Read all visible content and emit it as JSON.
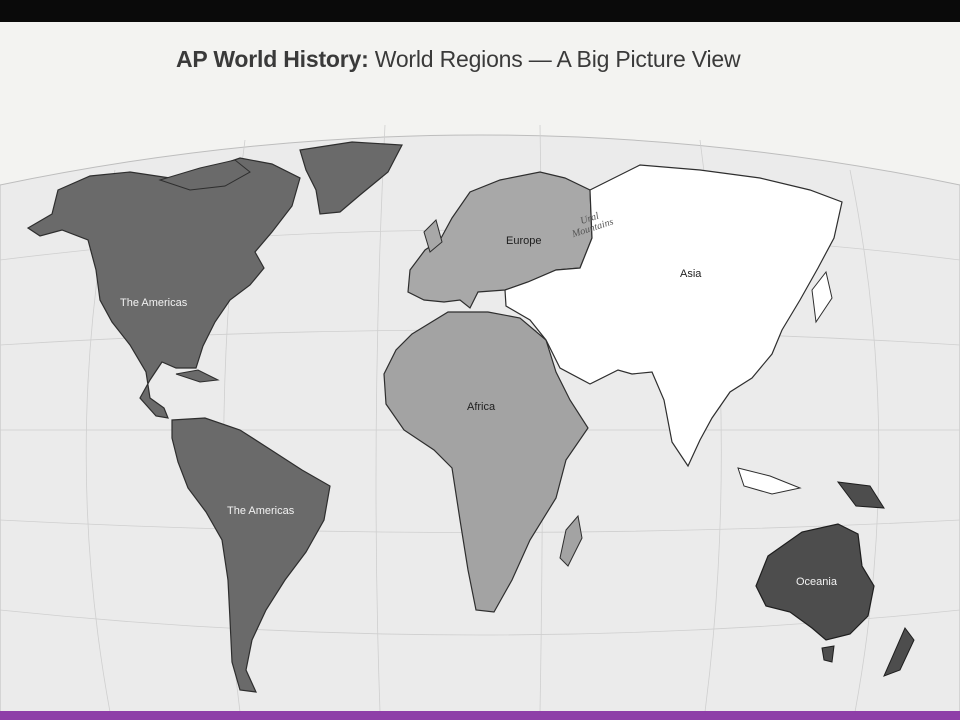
{
  "page": {
    "title_bold": "AP World History:",
    "title_rest": " World Regions — A Big Picture View"
  },
  "map": {
    "regions": {
      "americas_north": "The Americas",
      "americas_south": "The Americas",
      "europe": "Europe",
      "africa": "Africa",
      "asia": "Asia",
      "oceania": "Oceania"
    },
    "mountains": {
      "line1": "Ural",
      "line2": "Mountains"
    },
    "colors": {
      "americas": "#6a6a6a",
      "europe": "#a8a8a8",
      "africa": "#a3a3a3",
      "asia": "#ffffff",
      "oceania": "#4d4d4d",
      "background": "#ebebeb",
      "accent_bar": "#8e3fa8"
    }
  }
}
